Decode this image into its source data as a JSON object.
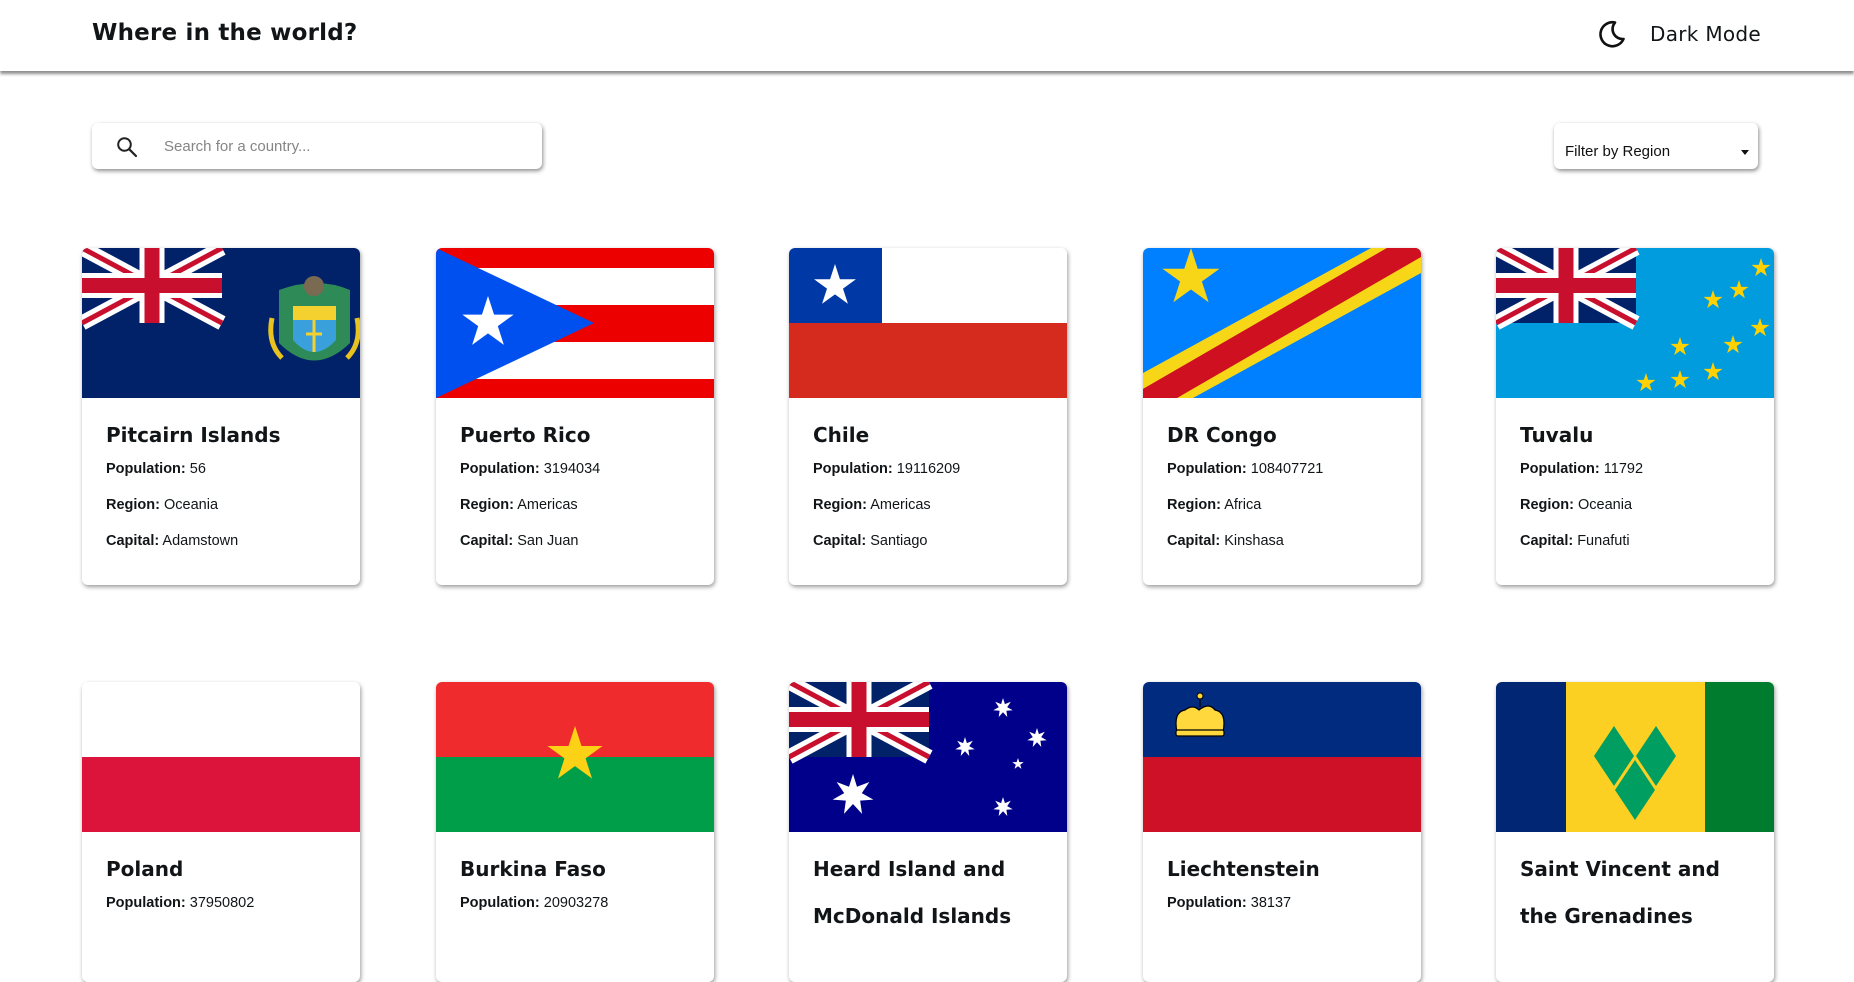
{
  "header": {
    "title": "Where in the world?",
    "mode_label": "Dark Mode"
  },
  "controls": {
    "search_placeholder": "Search for a country...",
    "search_value": "",
    "filter_label": "Filter by Region"
  },
  "labels": {
    "population": "Population:",
    "region": "Region:",
    "capital": "Capital:"
  },
  "countries": [
    {
      "name": "Pitcairn Islands",
      "population": "56",
      "region": "Oceania",
      "capital": "Adamstown",
      "flag": "pitcairn"
    },
    {
      "name": "Puerto Rico",
      "population": "3194034",
      "region": "Americas",
      "capital": "San Juan",
      "flag": "puerto-rico"
    },
    {
      "name": "Chile",
      "population": "19116209",
      "region": "Americas",
      "capital": "Santiago",
      "flag": "chile"
    },
    {
      "name": "DR Congo",
      "population": "108407721",
      "region": "Africa",
      "capital": "Kinshasa",
      "flag": "dr-congo"
    },
    {
      "name": "Tuvalu",
      "population": "11792",
      "region": "Oceania",
      "capital": "Funafuti",
      "flag": "tuvalu"
    },
    {
      "name": "Poland",
      "population": "37950802",
      "flag": "poland"
    },
    {
      "name": "Burkina Faso",
      "population": "20903278",
      "flag": "burkina-faso"
    },
    {
      "name": "Heard Island and McDonald Islands",
      "flag": "heard-island"
    },
    {
      "name": "Liechtenstein",
      "population": "38137",
      "flag": "liechtenstein"
    },
    {
      "name": "Saint Vincent and the Grenadines",
      "flag": "saint-vincent"
    }
  ],
  "colors": {
    "header_bg": "#ffffff",
    "page_bg": "#ffffff",
    "text": "#111517"
  }
}
